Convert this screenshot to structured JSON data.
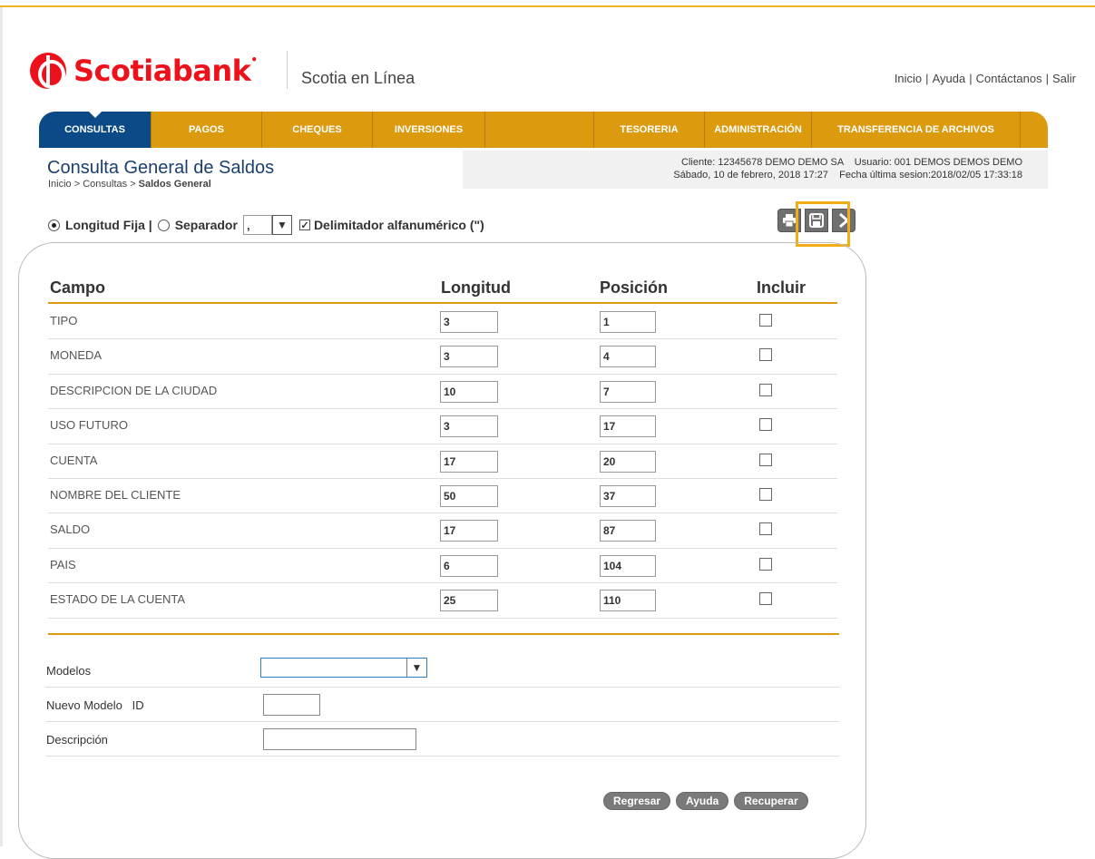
{
  "brand": {
    "logo_text": "Scotiabank",
    "product": "Scotia en Línea"
  },
  "top_links": [
    "Inicio",
    "Ayuda",
    "Contáctanos",
    "Salir"
  ],
  "top_links_sep": "|",
  "nav": [
    {
      "label": "CONSULTAS",
      "active": true
    },
    {
      "label": "PAGOS"
    },
    {
      "label": "CHEQUES"
    },
    {
      "label": "INVERSIONES"
    },
    {
      "label": ""
    },
    {
      "label": "TESORERIA"
    },
    {
      "label": "ADMINISTRACIÓN"
    },
    {
      "label": "TRANSFERENCIA DE ARCHIVOS"
    }
  ],
  "page": {
    "title": "Consulta General de Saldos",
    "breadcrumb_prefix": "Inicio > Consultas > ",
    "breadcrumb_current": "Saldos General"
  },
  "session": {
    "line1": "Cliente: 12345678 DEMO DEMO SA    Usuario: 001 DEMOS DEMOS DEMO",
    "line2": "Sábado, 10 de febrero, 2018 17:27    Fecha última sesion:2018/02/05 17:33:18"
  },
  "options": {
    "fixed_label": "Longitud Fija |",
    "separator_label": "Separador",
    "separator_value": ",",
    "delimiter_label": "Delimitador alfanumérico (\")",
    "delimiter_checked": true,
    "checkmark": "✓",
    "dropdown_arrow": "▼"
  },
  "tools": {
    "print_icon": "print-icon",
    "save_icon": "floppy-disk-icon",
    "next_icon": "chevron-right-icon"
  },
  "table": {
    "headers": {
      "campo": "Campo",
      "longitud": "Longitud",
      "posicion": "Posición",
      "incluir": "Incluir"
    },
    "rows": [
      {
        "campo": "TIPO",
        "longitud": "3",
        "posicion": "1"
      },
      {
        "campo": "MONEDA",
        "longitud": "3",
        "posicion": "4"
      },
      {
        "campo": "DESCRIPCION DE LA CIUDAD",
        "longitud": "10",
        "posicion": "7"
      },
      {
        "campo": "USO FUTURO",
        "longitud": "3",
        "posicion": "17"
      },
      {
        "campo": "CUENTA",
        "longitud": "17",
        "posicion": "20"
      },
      {
        "campo": "NOMBRE DEL CLIENTE",
        "longitud": "50",
        "posicion": "37"
      },
      {
        "campo": "SALDO",
        "longitud": "17",
        "posicion": "87"
      },
      {
        "campo": "PAIS",
        "longitud": "6",
        "posicion": "104"
      },
      {
        "campo": "ESTADO DE LA CUENTA",
        "longitud": "25",
        "posicion": "110"
      }
    ]
  },
  "form": {
    "modelos_label": "Modelos",
    "modelos_value": "",
    "nuevo_modelo_label": "Nuevo Modelo   ID",
    "nuevo_modelo_value": "",
    "descripcion_label": "Descripción",
    "descripcion_value": ""
  },
  "buttons": {
    "regresar": "Regresar",
    "ayuda": "Ayuda",
    "recuperar": "Recuperar"
  },
  "colors": {
    "brand_red": "#ec111a",
    "nav_gold": "#dc9a0e",
    "nav_active": "#0b4a86",
    "highlight": "#f2ad16"
  }
}
